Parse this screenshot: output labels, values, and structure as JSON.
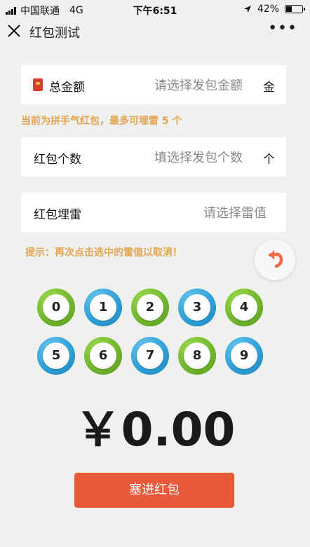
{
  "status_bar": {
    "carrier": "中国联通",
    "network": "4G",
    "time": "下午6:51",
    "battery": "42%",
    "battery_level": 0.42
  },
  "nav": {
    "title": "红包测试",
    "more": "•••"
  },
  "form": {
    "amount": {
      "label": "总金额",
      "placeholder": "请选择发包金额",
      "unit": "金"
    },
    "amount_hint": "当前为拼手气红包，最多可埋雷 5 个",
    "count": {
      "label": "红包个数",
      "placeholder": "填选择发包个数",
      "unit": "个"
    },
    "mine": {
      "label": "红包埋雷",
      "placeholder": "请选择雷值"
    },
    "mine_hint": "提示：再次点击选中的雷值以取消！"
  },
  "balls": [
    {
      "label": "0",
      "color": "green"
    },
    {
      "label": "1",
      "color": "blue"
    },
    {
      "label": "2",
      "color": "green"
    },
    {
      "label": "3",
      "color": "blue"
    },
    {
      "label": "4",
      "color": "green"
    },
    {
      "label": "5",
      "color": "blue"
    },
    {
      "label": "6",
      "color": "green"
    },
    {
      "label": "7",
      "color": "blue"
    },
    {
      "label": "8",
      "color": "green"
    },
    {
      "label": "9",
      "color": "blue"
    }
  ],
  "total": "￥0.00",
  "submit_label": "塞进红包",
  "colors": {
    "accent": "#e95a3a",
    "hint": "#e3a553",
    "ball_green": "#6fb42c",
    "ball_blue": "#2b9ed6"
  },
  "icons": {
    "close": "close-icon",
    "undo": "undo-icon",
    "redpack": "red-packet-icon"
  }
}
